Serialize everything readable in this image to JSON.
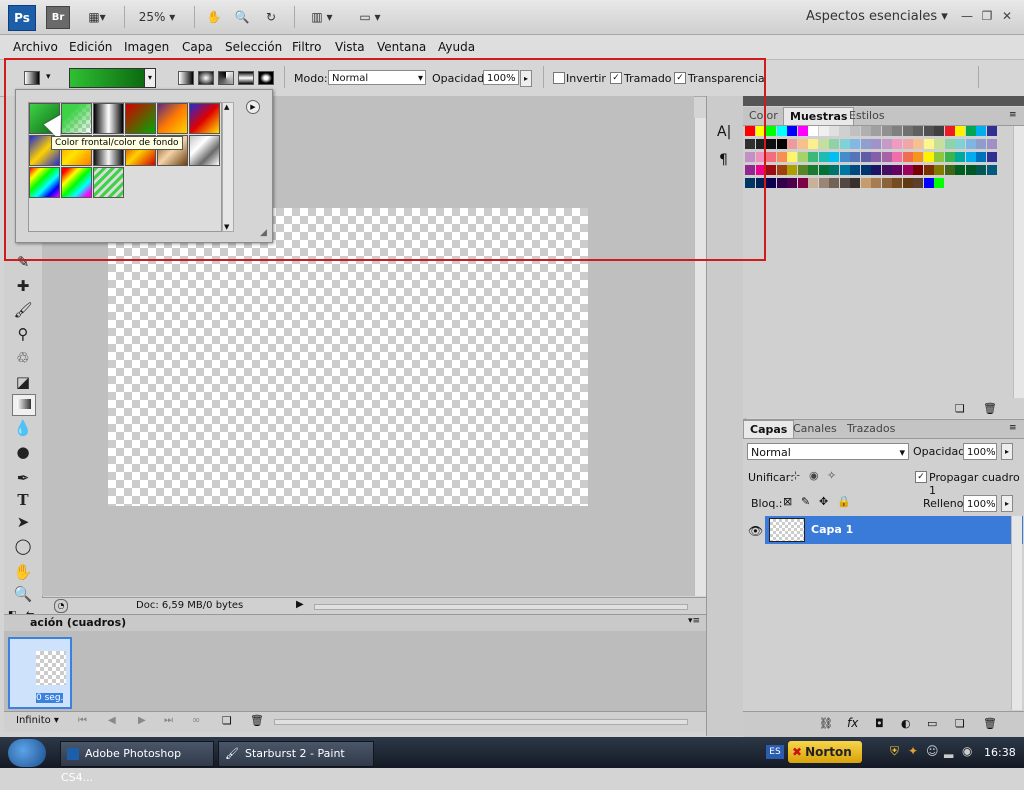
{
  "appbar": {
    "ps": "Ps",
    "br": "Br",
    "zoom": "25%",
    "workspace": "Aspectos esenciales"
  },
  "menu": [
    "Archivo",
    "Edición",
    "Imagen",
    "Capa",
    "Selección",
    "Filtro",
    "Vista",
    "Ventana",
    "Ayuda"
  ],
  "options": {
    "mode_label": "Modo:",
    "mode_value": "Normal",
    "opacity_label": "Opacidad:",
    "opacity_value": "100%",
    "invert": "Invertir",
    "dither": "Tramado",
    "transparency": "Transparencia"
  },
  "gradient_picker": {
    "tooltip": "Color frontal/color de fondo"
  },
  "doc": {
    "info": "Doc: 6,59 MB/0 bytes"
  },
  "animation": {
    "title": "ación (cuadros)",
    "frame_time": "0 seg.",
    "loop": "Infinito"
  },
  "swatch_panel": {
    "tabs": [
      "Color",
      "Muestras",
      "Estilos"
    ],
    "active": "Muestras"
  },
  "layers_panel": {
    "tabs": [
      "Capas",
      "Canales",
      "Trazados"
    ],
    "active": "Capas",
    "blend": "Normal",
    "opacity_label": "Opacidad:",
    "opacity_value": "100%",
    "unify_label": "Unificar:",
    "propagate": "Propagar cuadro 1",
    "lock_label": "Bloq.:",
    "fill_label": "Relleno:",
    "fill_value": "100%",
    "layer_name": "Capa 1"
  },
  "taskbar": {
    "items": [
      "Adobe Photoshop CS4...",
      "Starburst 2 - Paint"
    ],
    "lang": "ES",
    "norton": "Norton",
    "clock": "16:38"
  }
}
